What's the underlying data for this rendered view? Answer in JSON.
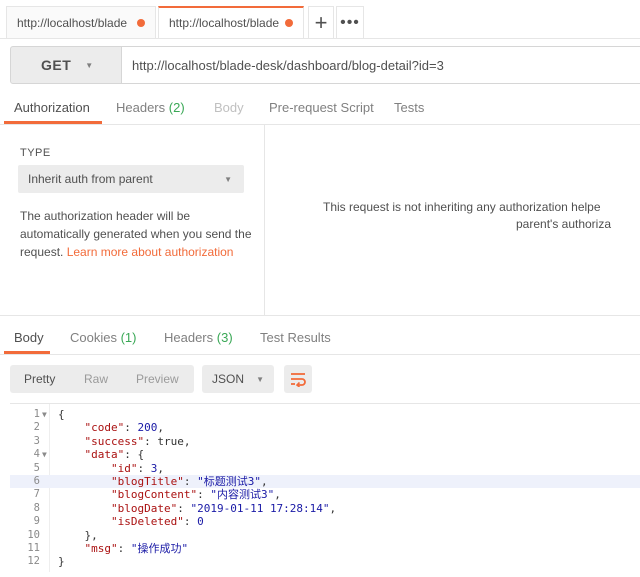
{
  "tabs": [
    {
      "label": "http://localhost/blade"
    },
    {
      "label": "http://localhost/blade"
    }
  ],
  "tab_actions": {
    "add": "+",
    "more": "•••"
  },
  "request": {
    "method": "GET",
    "url": "http://localhost/blade-desk/dashboard/blog-detail?id=3"
  },
  "request_tabs": {
    "authorization": "Authorization",
    "headers": "Headers",
    "headers_count": "(2)",
    "body": "Body",
    "prerequest": "Pre-request Script",
    "tests": "Tests"
  },
  "auth": {
    "type_label": "TYPE",
    "type_value": "Inherit auth from parent",
    "description": "The authorization header will be automatically generated when you send the request.",
    "link_text": "Learn more about authorization",
    "message_line1": "This request is not inheriting any authorization helpe",
    "message_line2": "parent's authoriza"
  },
  "response_tabs": {
    "body": "Body",
    "cookies": "Cookies",
    "cookies_count": "(1)",
    "headers": "Headers",
    "headers_count": "(3)",
    "test_results": "Test Results"
  },
  "format": {
    "pretty": "Pretty",
    "raw": "Raw",
    "preview": "Preview",
    "language": "JSON"
  },
  "colors": {
    "accent": "#f26b3a",
    "count_green": "#3aa856"
  },
  "code_lines": [
    {
      "n": "1",
      "fold": true,
      "html": "{"
    },
    {
      "n": "2",
      "fold": false,
      "html": "    <span class='k'>\"code\"</span>: <span class='n'>200</span>,"
    },
    {
      "n": "3",
      "fold": false,
      "html": "    <span class='k'>\"success\"</span>: true,"
    },
    {
      "n": "4",
      "fold": true,
      "html": "    <span class='k'>\"data\"</span>: {"
    },
    {
      "n": "5",
      "fold": false,
      "html": "        <span class='k'>\"id\"</span>: <span class='n'>3</span>,"
    },
    {
      "n": "6",
      "fold": false,
      "html": "        <span class='k'>\"blogTitle\"</span>: <span class='s'>\"标题测试3\"</span>,"
    },
    {
      "n": "7",
      "fold": false,
      "html": "        <span class='k'>\"blogContent\"</span>: <span class='s'>\"内容测试3\"</span>,"
    },
    {
      "n": "8",
      "fold": false,
      "html": "        <span class='k'>\"blogDate\"</span>: <span class='s'>\"2019-01-11 17:28:14\"</span>,"
    },
    {
      "n": "9",
      "fold": false,
      "html": "        <span class='k'>\"isDeleted\"</span>: <span class='n'>0</span>"
    },
    {
      "n": "10",
      "fold": false,
      "html": "    },"
    },
    {
      "n": "11",
      "fold": false,
      "html": "    <span class='k'>\"msg\"</span>: <span class='s'>\"操作成功\"</span>"
    },
    {
      "n": "12",
      "fold": false,
      "html": "}"
    }
  ],
  "highlighted_line": "6"
}
